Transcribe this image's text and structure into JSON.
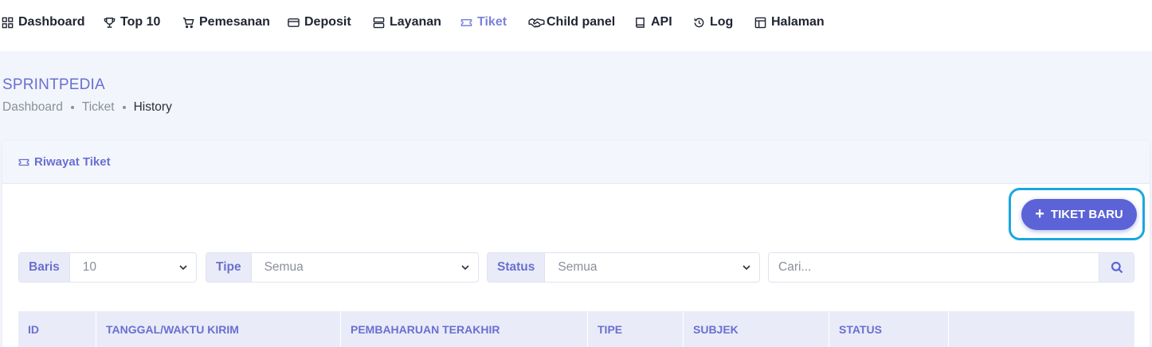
{
  "nav": {
    "items": [
      {
        "label": "Dashboard",
        "icon": "grid-icon"
      },
      {
        "label": "Top 10",
        "icon": "trophy-icon"
      },
      {
        "label": "Pemesanan",
        "icon": "cart-icon"
      },
      {
        "label": "Deposit",
        "icon": "card-icon"
      },
      {
        "label": "Layanan",
        "icon": "server-icon"
      },
      {
        "label": "Tiket",
        "icon": "ticket-icon",
        "active": true
      },
      {
        "label": "Child panel",
        "icon": "handshake-icon"
      },
      {
        "label": "API",
        "icon": "book-icon"
      },
      {
        "label": "Log",
        "icon": "history-icon"
      },
      {
        "label": "Halaman",
        "icon": "layout-icon"
      }
    ]
  },
  "page": {
    "title": "SPRINTPEDIA",
    "breadcrumb": [
      "Dashboard",
      "Ticket",
      "History"
    ]
  },
  "card": {
    "title": "Riwayat Tiket",
    "new_button": "TIKET BARU"
  },
  "filters": {
    "rows": {
      "label": "Baris",
      "value": "10"
    },
    "type": {
      "label": "Tipe",
      "value": "Semua"
    },
    "status": {
      "label": "Status",
      "value": "Semua"
    },
    "search_placeholder": "Cari..."
  },
  "table": {
    "columns": [
      "ID",
      "TANGGAL/WAKTU KIRIM",
      "PEMBAHARUAN TERAKHIR",
      "TIPE",
      "SUBJEK",
      "STATUS",
      ""
    ]
  },
  "colors": {
    "accent": "#5b63d6",
    "accent_text": "#6a6fd0",
    "highlight_outline": "#1aa7e0",
    "page_bg": "#f2f5fb"
  }
}
